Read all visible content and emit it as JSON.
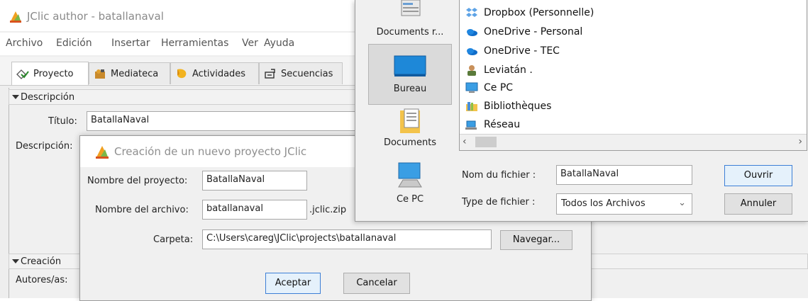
{
  "app": {
    "title": "JClic author - batallanaval",
    "menu": [
      "Archivo",
      "Edición",
      "Insertar",
      "Herramientas",
      "Ver",
      "Ayuda"
    ],
    "tabs": [
      "Proyecto",
      "Mediateca",
      "Actividades",
      "Secuencias"
    ],
    "active_tab": "Proyecto"
  },
  "project_panel": {
    "description_section": "Descripción",
    "title_label": "Título:",
    "title_value": "BatallaNaval",
    "description_label": "Descripción:",
    "creation_section": "Creación",
    "authors_label": "Autores/as:"
  },
  "new_project_dialog": {
    "title": "Creación de un nuevo proyecto JClic",
    "project_name_label": "Nombre del proyecto:",
    "project_name_value": "BatallaNaval",
    "file_name_label": "Nombre del archivo:",
    "file_name_value": "batallanaval",
    "file_extension": ".jclic.zip",
    "folder_label": "Carpeta:",
    "folder_value": "C:\\Users\\careg\\JClic\\projects\\batallanaval",
    "browse_button": "Navegar...",
    "accept_button": "Aceptar",
    "cancel_button": "Cancelar"
  },
  "file_dialog": {
    "places": [
      {
        "label": "Documents r...",
        "icon": "recent-documents-icon"
      },
      {
        "label": "Bureau",
        "icon": "desktop-icon"
      },
      {
        "label": "Documents",
        "icon": "documents-folder-icon"
      },
      {
        "label": "Ce PC",
        "icon": "computer-icon"
      }
    ],
    "selected_place": "Bureau",
    "files": [
      {
        "label": "Dropbox (Personnelle)",
        "icon": "dropbox-icon"
      },
      {
        "label": "OneDrive - Personal",
        "icon": "onedrive-icon"
      },
      {
        "label": "OneDrive - TEC",
        "icon": "onedrive-icon"
      },
      {
        "label": "Leviatán .",
        "icon": "user-icon"
      },
      {
        "label": "Ce PC",
        "icon": "computer-icon"
      },
      {
        "label": "Bibliothèques",
        "icon": "libraries-icon"
      },
      {
        "label": "Réseau",
        "icon": "network-icon"
      }
    ],
    "file_name_label": "Nom du fichier :",
    "file_name_value": "BatallaNaval",
    "file_type_label": "Type de fichier :",
    "file_type_value": "Todos los Archivos",
    "open_button": "Ouvrir",
    "cancel_button": "Annuler"
  }
}
